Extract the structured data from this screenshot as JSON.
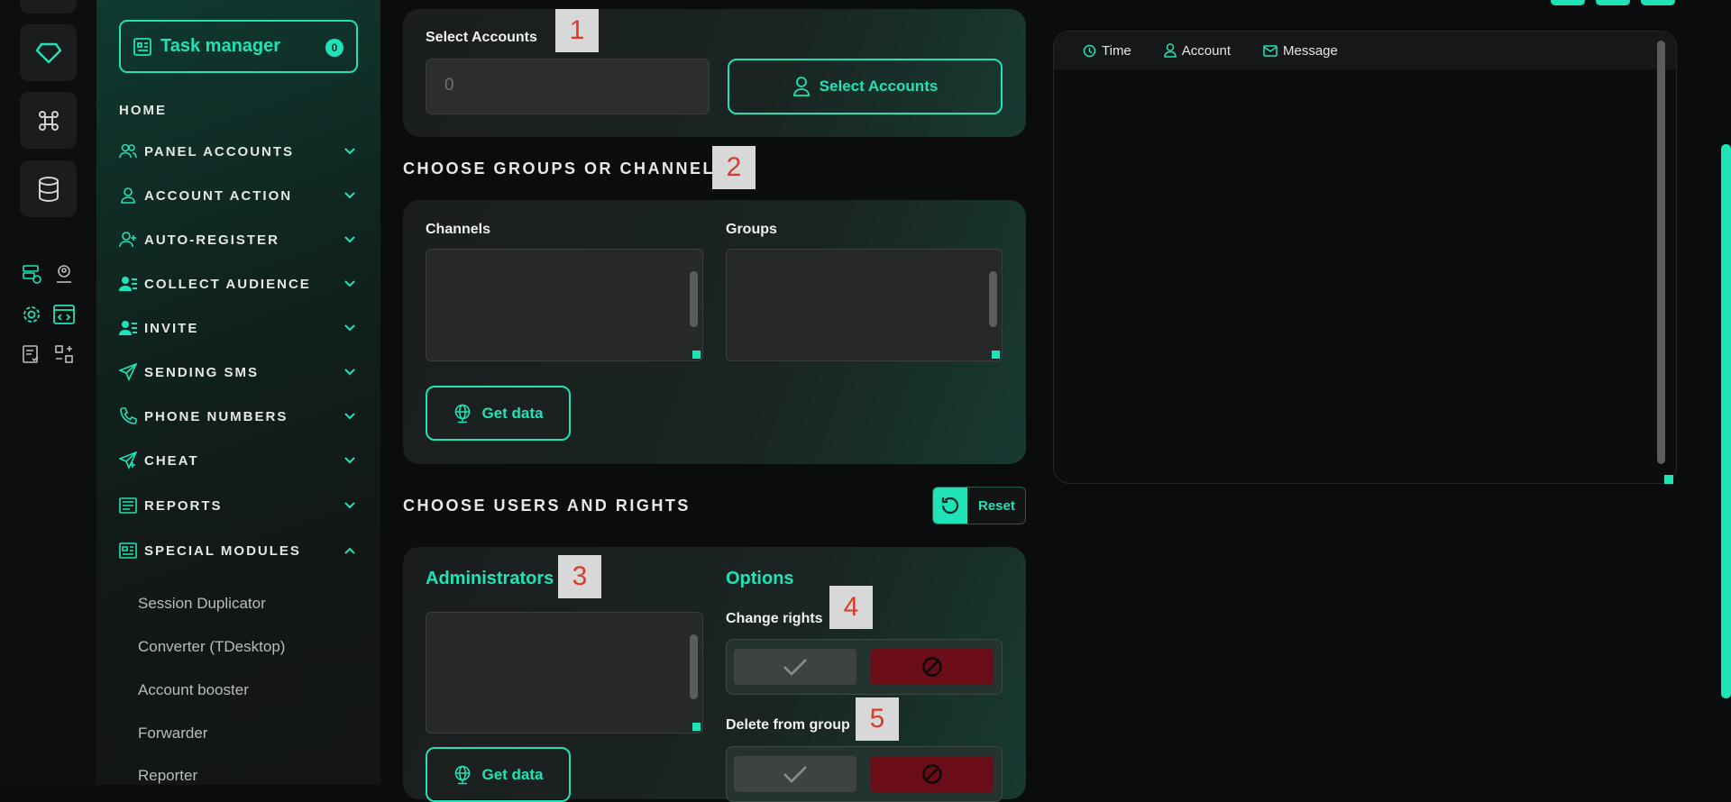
{
  "sidebar": {
    "task_manager": {
      "label": "Task manager",
      "count": "0"
    },
    "home": "HOME",
    "items": [
      {
        "label": "PANEL ACCOUNTS",
        "icon": "users-icon"
      },
      {
        "label": "ACCOUNT ACTION",
        "icon": "user-icon"
      },
      {
        "label": "AUTO-REGISTER",
        "icon": "user-plus-icon"
      },
      {
        "label": "COLLECT AUDIENCE",
        "icon": "user-list-icon"
      },
      {
        "label": "INVITE",
        "icon": "user-list-icon"
      },
      {
        "label": "SENDING SMS",
        "icon": "send-icon"
      },
      {
        "label": "PHONE NUMBERS",
        "icon": "phone-icon"
      },
      {
        "label": "CHEAT",
        "icon": "send-plus-icon"
      },
      {
        "label": "REPORTS",
        "icon": "report-icon"
      },
      {
        "label": "SPECIAL MODULES",
        "icon": "modules-icon"
      }
    ],
    "sub_items": [
      "Session Duplicator",
      "Converter (TDesktop)",
      "Account booster",
      "Forwarder",
      "Reporter"
    ]
  },
  "accounts": {
    "label": "Select Accounts",
    "value": "0",
    "button": "Select Accounts",
    "marker": "1"
  },
  "groups": {
    "title": "CHOOSE GROUPS OR CHANNELS",
    "marker": "2",
    "channels_label": "Channels",
    "groups_label": "Groups",
    "get_data": "Get data"
  },
  "users": {
    "title": "CHOOSE USERS AND RIGHTS",
    "reset": "Reset",
    "admins_label": "Administrators",
    "admins_marker": "3",
    "options_label": "Options",
    "change_rights": "Change rights",
    "change_marker": "4",
    "delete_group": "Delete from group",
    "delete_marker": "5",
    "get_data": "Get data"
  },
  "log": {
    "columns": [
      "Time",
      "Account",
      "Message"
    ]
  },
  "colors": {
    "accent": "#1fe3b6",
    "danger": "#6b0d16"
  }
}
